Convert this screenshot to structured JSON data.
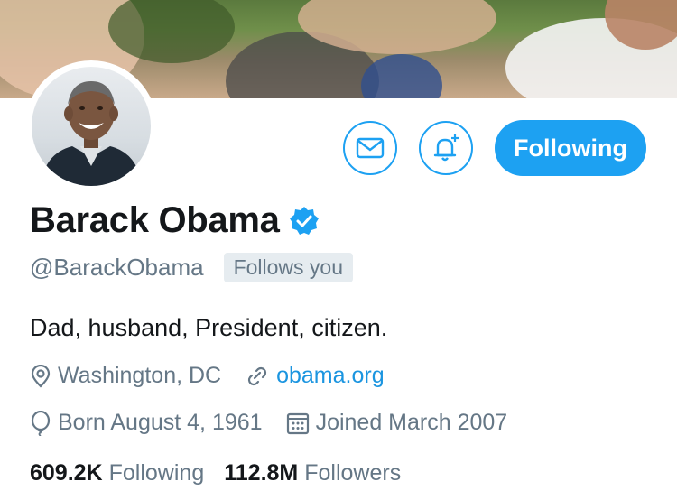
{
  "colors": {
    "accent": "#1da1f2",
    "link": "#1b95e0",
    "secondary_text": "#657786",
    "primary_text": "#14171a",
    "badge_bg": "#e6ecf0"
  },
  "header": {
    "banner": "crowd-photo",
    "avatar": "profile-photo"
  },
  "actions": {
    "message_icon": "envelope-icon",
    "notify_icon": "bell-plus-icon",
    "follow_label": "Following"
  },
  "profile": {
    "name": "Barack Obama",
    "verified_icon": "verified-badge-icon",
    "handle": "@BarackObama",
    "follows_you": "Follows you",
    "bio": "Dad, husband, President, citizen.",
    "location": "Washington, DC",
    "website": "obama.org",
    "birthday": "Born August 4, 1961",
    "joined": "Joined March 2007"
  },
  "stats": {
    "following_count": "609.2K",
    "following_label": "Following",
    "followers_count": "112.8M",
    "followers_label": "Followers"
  }
}
